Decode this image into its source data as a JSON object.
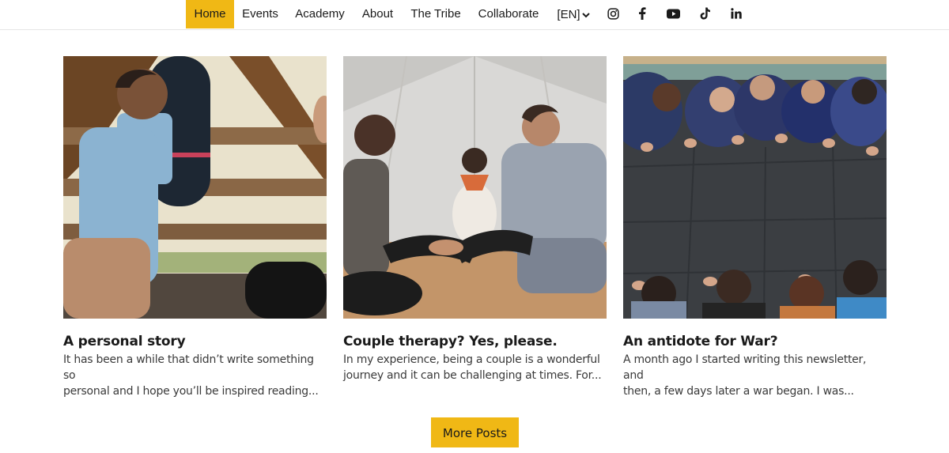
{
  "nav": {
    "items": [
      {
        "label": "Home"
      },
      {
        "label": "Events"
      },
      {
        "label": "Academy"
      },
      {
        "label": "About"
      },
      {
        "label": "The Tribe"
      },
      {
        "label": "Collaborate"
      }
    ],
    "language": "[EN]",
    "social": [
      "instagram-icon",
      "facebook-icon",
      "youtube-icon",
      "tiktok-icon",
      "linkedin-icon"
    ]
  },
  "posts": [
    {
      "title": "A personal story",
      "excerpt_line1": "It has been a while that didn’t write something so",
      "excerpt_line2": "personal and I hope you’ll be inspired reading..."
    },
    {
      "title": "Couple therapy? Yes, please.",
      "excerpt_line1": "In my experience, being a couple is a wonderful",
      "excerpt_line2": "journey and it can be challenging at times. For..."
    },
    {
      "title": "An antidote for War?",
      "excerpt_line1": "A month ago I started writing this newsletter, and",
      "excerpt_line2": "then, a few days later a war began. I was..."
    }
  ],
  "more_button": "More Posts",
  "colors": {
    "accent": "#f0b815"
  }
}
